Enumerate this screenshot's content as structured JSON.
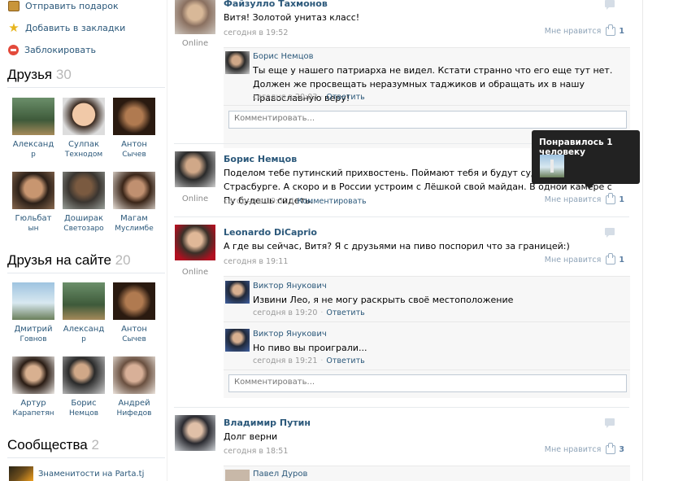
{
  "sidebar": {
    "actions": [
      {
        "label": "Отправить подарок",
        "icon": "gift-icon"
      },
      {
        "label": "Добавить в закладки",
        "icon": "star-icon"
      },
      {
        "label": "Заблокировать",
        "icon": "block-icon"
      }
    ],
    "friends": {
      "title": "Друзья",
      "count": "30",
      "items": [
        {
          "name": "Александ",
          "line2": "р"
        },
        {
          "name": "Сулпак",
          "line2": "Технодом"
        },
        {
          "name": "Антон",
          "line2": "Сычев"
        },
        {
          "name": "Гюльбат",
          "line2": "ын"
        },
        {
          "name": "Доширак",
          "line2": "Светозаро"
        },
        {
          "name": "Магам",
          "line2": "Муслимбе"
        }
      ]
    },
    "friends_online": {
      "title": "Друзья на сайте",
      "count": "20",
      "items": [
        {
          "name": "Дмитрий",
          "line2": "Говнов"
        },
        {
          "name": "Александ",
          "line2": "р"
        },
        {
          "name": "Антон",
          "line2": "Сычев"
        },
        {
          "name": "Артур",
          "line2": "Карапетян"
        },
        {
          "name": "Борис",
          "line2": "Немцов"
        },
        {
          "name": "Андрей",
          "line2": "Нифедов"
        }
      ]
    },
    "communities": {
      "title": "Сообщества",
      "count": "2",
      "first": "Знаменитости на Parta.tj"
    }
  },
  "posts": [
    {
      "author": "Файзулло Тахмонов",
      "text": "Витя! Золотой унитаз класс!",
      "time": "сегодня в 19:52",
      "online": "Online",
      "like_label": "Мне нравится",
      "like_count": "1",
      "replies": [
        {
          "author": "Борис Немцов",
          "text": "Ты еще у нашего патриарха не видел. Кстати странно что его еще тут нет. Должен же просвещать неразумных таджиков и обращать их в нашу Православную веру!",
          "time": "сегодня в 20:03",
          "action": "Ответить"
        }
      ],
      "comment_placeholder": "Комментировать..."
    },
    {
      "author": "Борис Немцов",
      "text": "Поделом тебе путинский прихвостень. Поймают тебя и будут судить в Страсбурге. А скоро и в России устроим с Лёшкой свой майдан. В одной камере с Пу будешь сидеть.",
      "time": "сегодня в 19:51",
      "action": "Комментировать",
      "online": "Online",
      "like_label": "Мне нравится",
      "like_count": "1"
    },
    {
      "author": "Leonardo DiCaprio",
      "text": "А где вы сейчас, Витя? Я с друзьями на пиво поспорил что за границей:)",
      "time": "сегодня в 19:11",
      "online": "Online",
      "like_label": "Мне нравится",
      "like_count": "1",
      "replies": [
        {
          "author": "Виктор Янукович",
          "text": "Извини Лео, я не могу раскрыть своё местоположение",
          "time": "сегодня в 19:20",
          "action": "Ответить"
        },
        {
          "author": "Виктор Янукович",
          "text": "Но пиво вы проиграли...",
          "time": "сегодня в 19:21",
          "action": "Ответить"
        }
      ],
      "comment_placeholder": "Комментировать..."
    },
    {
      "author": "Владимир Путин",
      "text": "Долг верни",
      "time": "сегодня в 18:51",
      "like_label": "Мне нравится",
      "like_count": "3",
      "replies": [
        {
          "author": "Павел Дуров"
        }
      ]
    }
  ],
  "tooltip": {
    "title": "Понравилось 1 человеку"
  }
}
